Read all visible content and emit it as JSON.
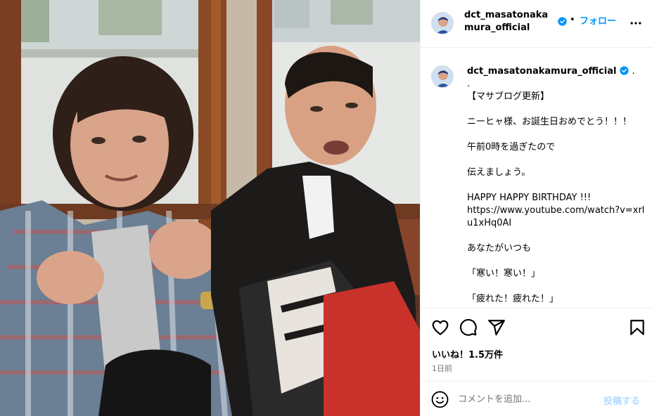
{
  "header": {
    "username": "dct_masatonakamura_official",
    "separator": "•",
    "follow_label": "フォロー",
    "more_icon": "more-horizontal-icon"
  },
  "caption": {
    "author": "dct_masatonakamura_official",
    "after_name": ".",
    "lines": [
      ".",
      "【マサブログ更新】",
      "",
      "ニーヒャ様、お誕生日おめでとう！！！",
      "",
      "午前0時を過ぎたので",
      "",
      "伝えましょう。",
      "",
      "HAPPY HAPPY BIRTHDAY !!!",
      "https://www.youtube.com/watch?v=xrlu1xHq0AI",
      "",
      "あなたがいつも",
      "",
      "「寒い！寒い！」",
      "",
      "「疲れた！疲れた！」"
    ]
  },
  "actions": {
    "icons": [
      "heart-icon",
      "comment-icon",
      "share-icon",
      "bookmark-icon"
    ],
    "likes": "いいね！1.5万件",
    "time": "1日前"
  },
  "comment": {
    "placeholder": "コメントを追加...",
    "post_label": "投稿する",
    "emoji_icon": "emoji-icon"
  },
  "colors": {
    "accent": "#0095f6",
    "verified": "#0095f6",
    "post_disabled": "#b3dbff",
    "muted": "#737373"
  }
}
